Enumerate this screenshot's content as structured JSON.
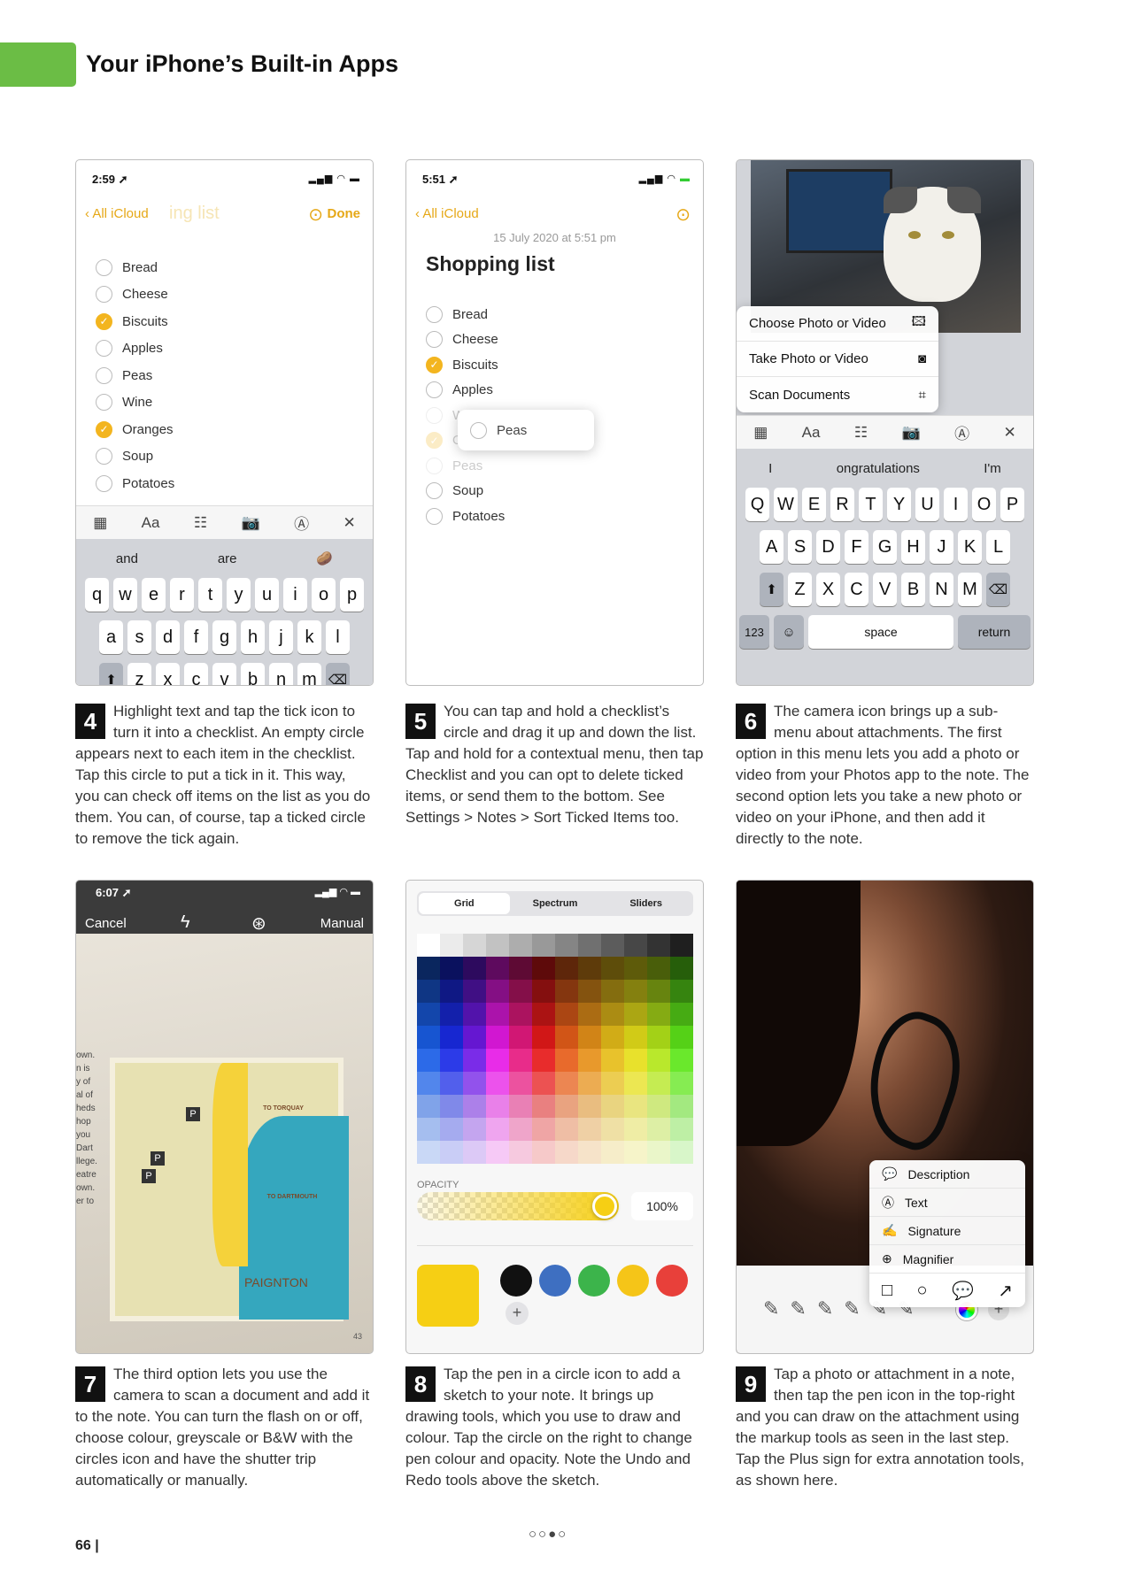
{
  "header": {
    "title": "Your iPhone’s Built-in Apps"
  },
  "shots": {
    "s4": {
      "time": "2:59",
      "back": "All iCloud",
      "ghost": "ing list",
      "done": "Done",
      "items": [
        "Bread",
        "Cheese",
        "Biscuits",
        "Apples",
        "Peas",
        "Wine",
        "Oranges",
        "Soup",
        "Potatoes"
      ],
      "checked": [
        false,
        false,
        true,
        false,
        false,
        false,
        true,
        false,
        false
      ],
      "tools": [
        "▦",
        "Aa",
        "☷",
        "📷",
        "Ⓐ",
        "✕"
      ],
      "suggestions": [
        "and",
        "are",
        "🥔"
      ],
      "row1": [
        "q",
        "w",
        "e",
        "r",
        "t",
        "y",
        "u",
        "i",
        "o",
        "p"
      ],
      "row2": [
        "a",
        "s",
        "d",
        "f",
        "g",
        "h",
        "j",
        "k",
        "l"
      ],
      "row3": [
        "z",
        "x",
        "c",
        "v",
        "b",
        "n",
        "m"
      ]
    },
    "s5": {
      "time": "5:51",
      "back": "All iCloud",
      "date": "15 July 2020 at 5:51 pm",
      "title": "Shopping list",
      "items": [
        "Bread",
        "Cheese",
        "Biscuits",
        "Apples",
        "Wine",
        "Oranges",
        "Peas",
        "Soup",
        "Potatoes"
      ],
      "checked": [
        false,
        false,
        true,
        false,
        false,
        true,
        false,
        false,
        false
      ],
      "drag": "Peas"
    },
    "s6": {
      "menu": [
        "Choose Photo or Video",
        "Take Photo or Video",
        "Scan Documents"
      ],
      "tools": [
        "▦",
        "Aa",
        "☷",
        "📷",
        "Ⓐ",
        "✕"
      ],
      "suggestions": [
        "I",
        "ongratulations",
        "I'm"
      ],
      "row1": [
        "Q",
        "W",
        "E",
        "R",
        "T",
        "Y",
        "U",
        "I",
        "O",
        "P"
      ],
      "row2": [
        "A",
        "S",
        "D",
        "F",
        "G",
        "H",
        "J",
        "K",
        "L"
      ],
      "row3": [
        "Z",
        "X",
        "C",
        "V",
        "B",
        "N",
        "M"
      ],
      "k123": "123",
      "space": "space",
      "return": "return"
    },
    "s7": {
      "time": "6:07",
      "cancel": "Cancel",
      "manual": "Manual",
      "margin": [
        "own.",
        "n is",
        "y of",
        "al of",
        "heds",
        "hop",
        "you",
        "Dart",
        "llege.",
        "eatre",
        "own.",
        "er to"
      ],
      "labels": {
        "torquay": "TO TORQUAY",
        "dartmouth": "TO DARTMOUTH",
        "paignton": "PAIGNTON",
        "page": "43"
      }
    },
    "s8": {
      "tabs": [
        "Grid",
        "Spectrum",
        "Sliders"
      ],
      "opacity_label": "OPACITY",
      "opacity": "100%",
      "swatches": [
        "#111111",
        "#3e6fc1",
        "#3cb44b",
        "#f5c518",
        "#e8403a"
      ],
      "selected": "#f6cf14",
      "plus": "+"
    },
    "s9": {
      "menu": [
        "Description",
        "Text",
        "Signature",
        "Magnifier"
      ],
      "shapes": [
        "□",
        "○",
        "💬",
        "↗"
      ]
    }
  },
  "captions": [
    {
      "n": "4",
      "text": "Highlight text and tap the tick icon to turn it into a checklist. An empty circle appears next to each item in the checklist. Tap this circle to put a tick in it. This way, you can check off items on the list as you do them. You can, of course, tap a ticked circle to remove the tick again."
    },
    {
      "n": "5",
      "text": "You can tap and hold a checklist’s circle and drag it up and down the list. Tap and hold for a contextual menu, then tap Checklist and you can opt to delete ticked items, or send them to the bottom. See Settings > Notes > Sort Ticked Items too."
    },
    {
      "n": "6",
      "text": "The camera icon brings up a sub-menu about attachments. The first option in this menu lets you add a photo or video from your Photos app to the note. The second option lets you take a new photo or video on your iPhone, and then add it directly to the note."
    },
    {
      "n": "7",
      "text": "The third option lets you use the camera to scan a document and add it to the note. You can turn the flash on or off, choose colour, greyscale or B&W with the circles icon and have the shutter trip automatically or manually."
    },
    {
      "n": "8",
      "text": "Tap the pen in a circle icon to add a sketch to your note. It brings up drawing tools, which you use to draw and colour. Tap the circle on the right to change pen colour and opacity. Note the Undo and Redo tools above the sketch."
    },
    {
      "n": "9",
      "text": "Tap a photo or attachment in a note, then tap the pen icon in the top-right and you can draw on the attachment using the markup tools as seen in the last step. Tap the Plus sign for extra annotation tools, as shown here."
    }
  ],
  "footer": {
    "page": "66",
    "sep": "|",
    "dots": "○○●○"
  }
}
